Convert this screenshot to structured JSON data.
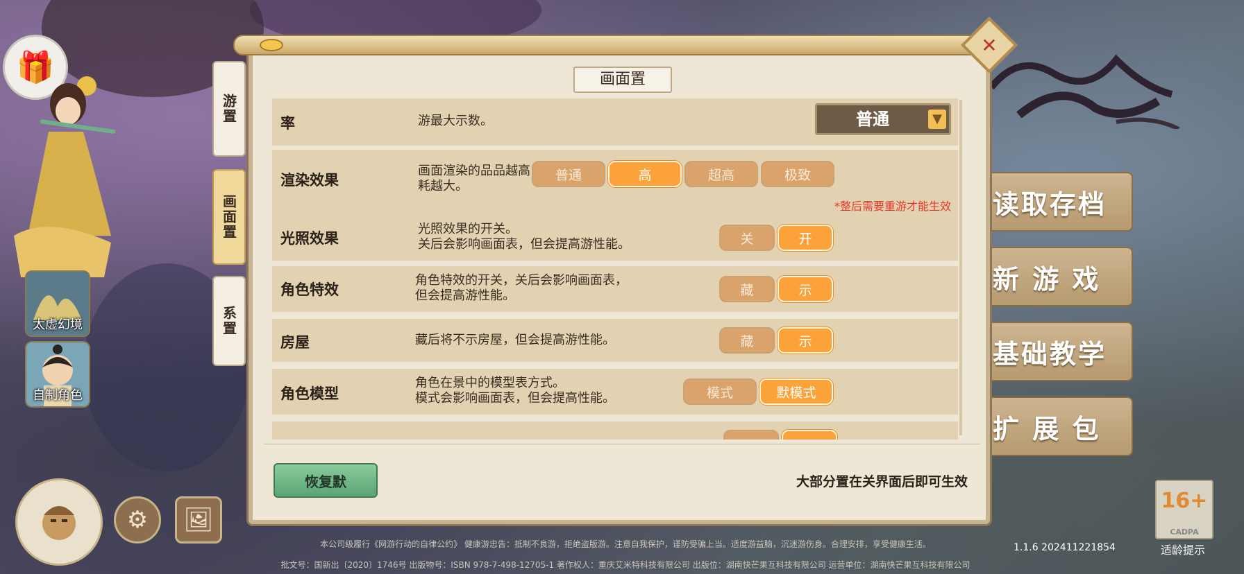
{
  "side_icons": [
    {
      "label": "太虚幻境"
    },
    {
      "label": "自制角色"
    }
  ],
  "tabs": [
    {
      "label": "游置",
      "active": false
    },
    {
      "label": "画面置",
      "active": true
    },
    {
      "label": "系置",
      "active": false
    }
  ],
  "panel": {
    "title": "画面置",
    "rows": [
      {
        "name": "率",
        "desc": "游最大示数。",
        "dropdown_value": "普通"
      },
      {
        "name": "渲染效果",
        "desc": "画面渲染的品品越高，性能消耗越大。",
        "options": [
          "普通",
          "高",
          "超高",
          "极致"
        ],
        "selected": "高",
        "note": "*整后需要重游才能生效"
      },
      {
        "name": "光照效果",
        "desc": "光照效果的开关。\n关后会影响画面表，但会提高游性能。",
        "options": [
          "关",
          "开"
        ],
        "selected": "开"
      },
      {
        "name": "角色特效",
        "desc": "角色特效的开关，关后会影响画面表，\n但会提高游性能。",
        "options": [
          "藏",
          "示"
        ],
        "selected": "示"
      },
      {
        "name": "房屋",
        "desc": "藏后将不示房屋，但会提高游性能。",
        "options": [
          "藏",
          "示"
        ],
        "selected": "示"
      },
      {
        "name": "角色模型",
        "desc": "角色在景中的模型表方式。\n模式会影响画面表，但会提高性能。",
        "options": [
          "模式",
          "默模式"
        ],
        "selected": "默模式"
      }
    ],
    "restore_label": "恢复默",
    "hint": "大部分置在关界面后即可生效"
  },
  "menu": {
    "buttons": [
      "读取存档",
      "新 游 戏",
      "基础教学",
      "扩 展 包"
    ]
  },
  "age_rating": {
    "label": "16+",
    "org": "CADPA",
    "tip": "适龄提示"
  },
  "version": "1.1.6 202411221854",
  "footer": {
    "line1": "本公司级履行《网游行动的自律公约》  健康游忠告：抵制不良游，拒绝盗版游。注意自我保护，谨防受骗上当。适度游益脑，沉迷游伤身。合理安排，享受健康生活。",
    "line2": "批文号：国新出〔2020〕1746号 出版物号：ISBN 978-7-498-12705-1 著作权人：重庆艾米特科技有限公司 出版位：湖南快芒果互科技有限公司 运营单位：湖南快芒果互科技有限公司"
  },
  "colors": {
    "accent": "#fba23a",
    "panel_bg": "#efe7d6",
    "row_bg": "#e3d2b1",
    "note_red": "#e23a2b"
  }
}
